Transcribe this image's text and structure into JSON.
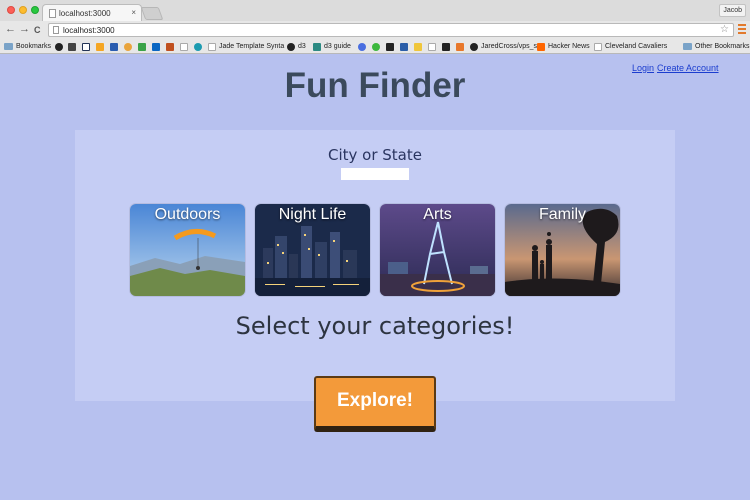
{
  "browser": {
    "tab_title": "localhost:3000",
    "tab_close": "×",
    "profile_name": "Jacob",
    "url": "localhost:3000",
    "back_icon": "←",
    "forward_icon": "→",
    "reload_icon": "C",
    "star_icon": "☆",
    "bookmarks_bar": {
      "folder_label": "Bookmarks",
      "items": [
        "Jade Template Synta",
        "d3",
        "d3 guide",
        "JaredCross/vps_set",
        "Hacker News",
        "Cleveland Cavaliers"
      ],
      "other_bookmarks": "Other Bookmarks"
    }
  },
  "header": {
    "title": "Fun Finder",
    "login_label": "Login",
    "create_account_label": "Create Account"
  },
  "search": {
    "city_label": "City or State",
    "city_value": ""
  },
  "categories": [
    {
      "label": "Outdoors",
      "icon": "paraglider-photo"
    },
    {
      "label": "Night Life",
      "icon": "city-skyline-photo"
    },
    {
      "label": "Arts",
      "icon": "light-sculpture-photo"
    },
    {
      "label": "Family",
      "icon": "family-silhouette-photo"
    }
  ],
  "prompt": "Select your categories!",
  "explore_label": "Explore!",
  "colors": {
    "page_bg": "#b7c1ef",
    "panel_bg": "#c5cdf4",
    "title": "#3b4a5c",
    "button": "#f39a3a"
  }
}
